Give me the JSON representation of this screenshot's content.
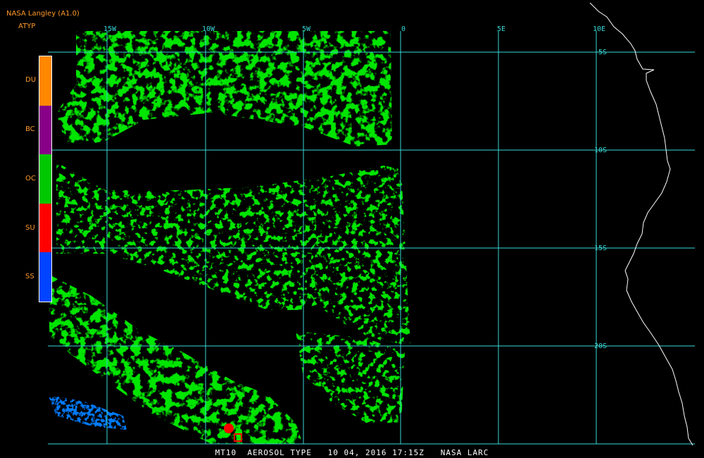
{
  "header": {
    "title": "NASA Langley (A1.0)",
    "product": "ATYP"
  },
  "legend": {
    "items": [
      {
        "label": "DU",
        "color": "#ff8800"
      },
      {
        "label": "BC",
        "color": "#880088"
      },
      {
        "label": "OC",
        "color": "#00c800"
      },
      {
        "label": "SU",
        "color": "#ff0000"
      },
      {
        "label": "SS",
        "color": "#0044ff"
      }
    ]
  },
  "map": {
    "lon_labels": [
      "15W",
      "10W",
      "5W",
      "0",
      "5E",
      "10E"
    ],
    "lat_labels": [
      "5S",
      "10S",
      "15S",
      "20S"
    ],
    "grid_color": "#38d8d8",
    "coast_color": "#ffffff"
  },
  "footer": {
    "text": "MT10  AEROSOL TYPE   10 04, 2016 17:15Z   NASA LARC"
  }
}
